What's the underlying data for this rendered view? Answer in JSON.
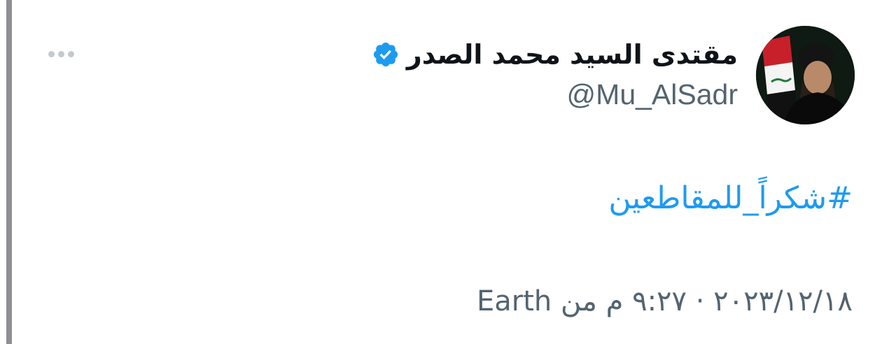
{
  "tweet": {
    "author": {
      "display_name": "مقتدى السيد محمد الصدر",
      "handle": "@Mu_AlSadr",
      "verified": true,
      "verified_icon": "verified-badge-icon",
      "avatar_icon": "profile-photo"
    },
    "text": {
      "hashtag": "#شكراً_للمقاطعين"
    },
    "meta": {
      "date_time": "٢٠٢٣/١٢/١٨ · ٩:٢٧ م",
      "via_prefix": "من",
      "source": "Earth"
    },
    "more_icon": "more-horizontal-icon"
  },
  "colors": {
    "link": "#1d9bf0",
    "text_primary": "#0f1419",
    "text_secondary": "#536471",
    "verified": "#1d9bf0"
  }
}
